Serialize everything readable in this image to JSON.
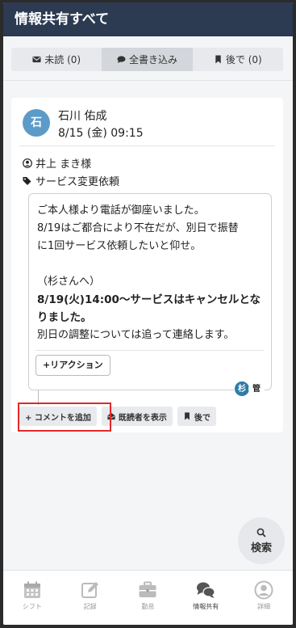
{
  "header": {
    "title": "情報共有すべて"
  },
  "tabs": [
    {
      "label": "未読 (0)",
      "icon": "envelope-icon",
      "active": false
    },
    {
      "label": "全書き込み",
      "icon": "comments-icon",
      "active": true
    },
    {
      "label": "後で (0)",
      "icon": "bookmark-icon",
      "active": false
    }
  ],
  "post": {
    "avatar_initial": "石",
    "author": "石川 佑成",
    "datetime": "8/15 (金) 09:15",
    "recipient": "井上 まき様",
    "tag": "サービス変更依頼",
    "message": {
      "line1": "ご本人様より電話が御座いました。",
      "line2": "8/19はご都合により不在だが、別日で振替",
      "line3": "に1回サービス依頼したいと仰せ。",
      "line4": "（杉さんへ）",
      "line5": "8/19(火)14:00～サービスはキャンセルとな",
      "line6": "りました。",
      "line7": "別日の調整については追って連絡します。"
    },
    "reaction_label": "+リアクション",
    "readers": [
      "杉",
      "管"
    ]
  },
  "actions": {
    "add_comment": "+ コメントを追加",
    "show_readers": "既読者を表示",
    "later": "後で"
  },
  "search": {
    "label": "検索"
  },
  "bottom_nav": [
    {
      "label": "シフト",
      "icon": "calendar-icon",
      "active": false
    },
    {
      "label": "記録",
      "icon": "edit-icon",
      "active": false
    },
    {
      "label": "勤怠",
      "icon": "briefcase-icon",
      "active": false
    },
    {
      "label": "情報共有",
      "icon": "chat-icon",
      "active": true
    },
    {
      "label": "詳細",
      "icon": "user-circle-icon",
      "active": false
    }
  ],
  "colors": {
    "header_bg": "#2c3a52",
    "avatar": "#5c9bc7",
    "highlight": "#e0282a"
  }
}
